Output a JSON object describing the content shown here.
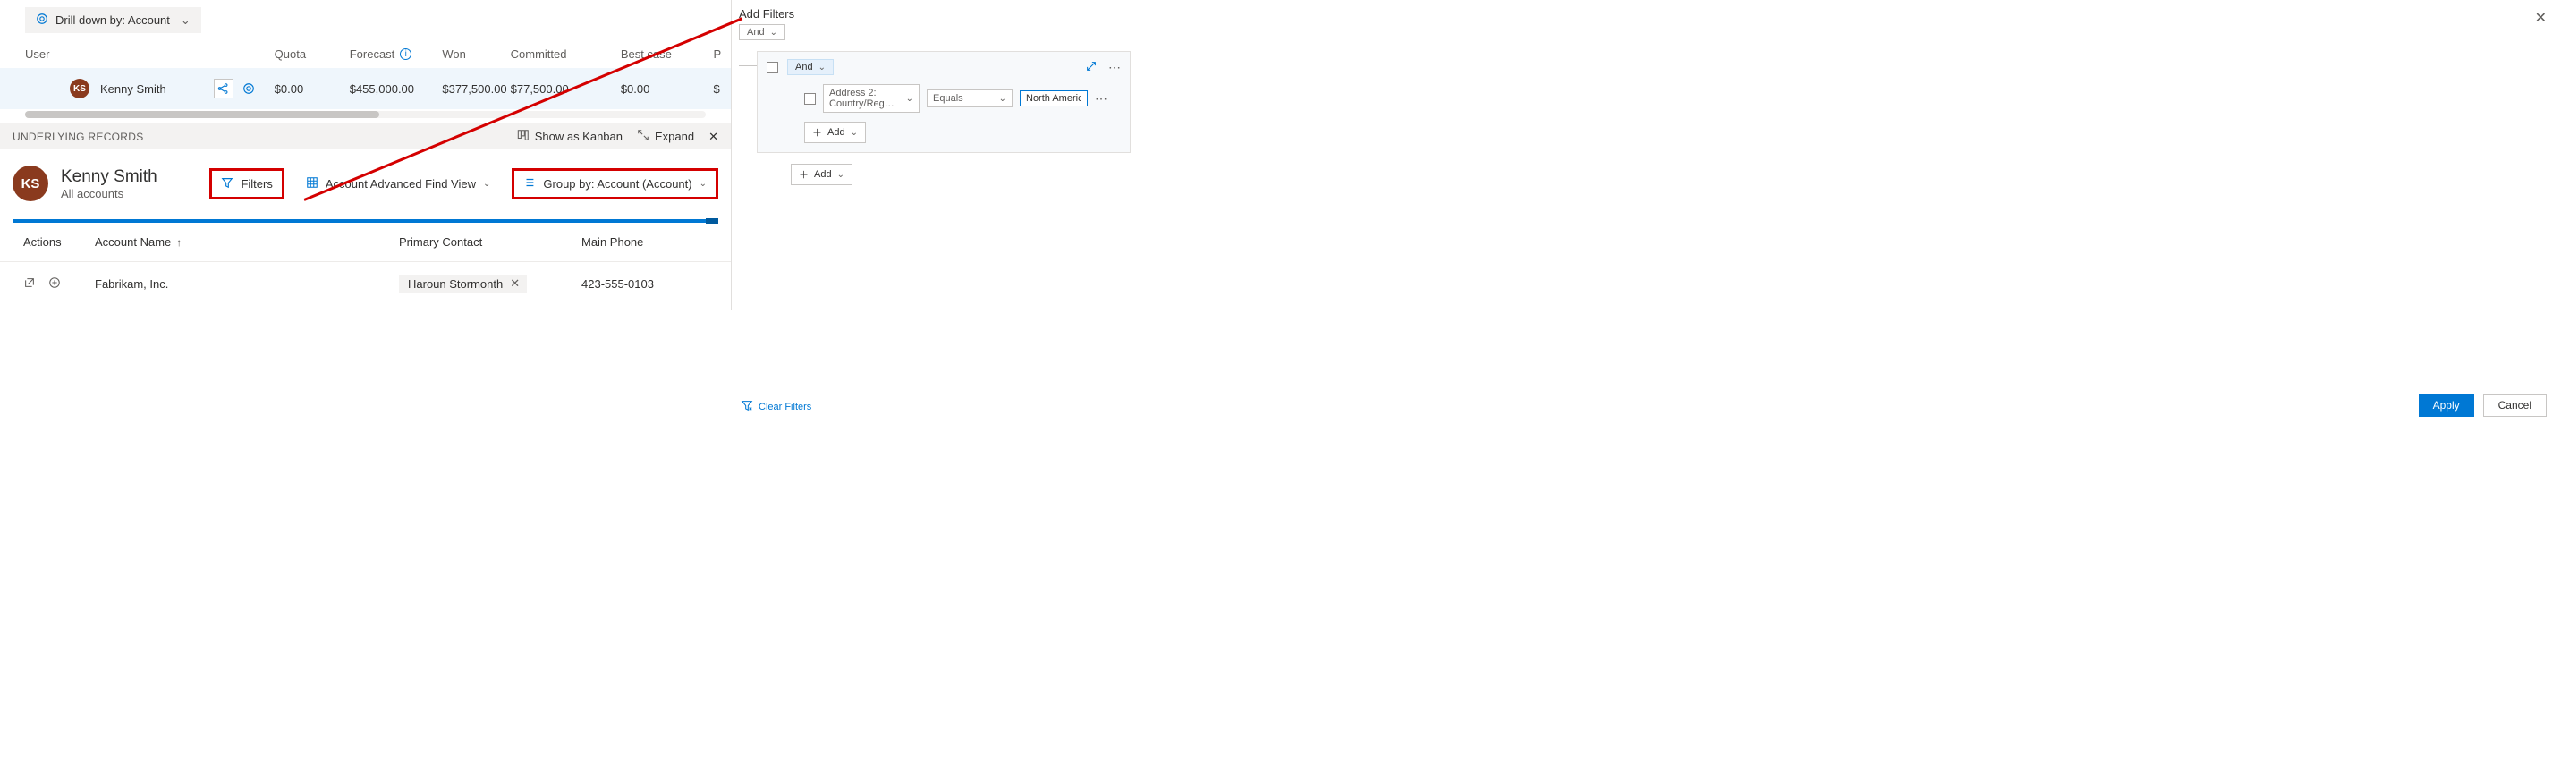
{
  "drilldown": {
    "label": "Drill down by: Account"
  },
  "grid": {
    "headers": {
      "user": "User",
      "quota": "Quota",
      "forecast": "Forecast",
      "won": "Won",
      "committed": "Committed",
      "bestcase": "Best case",
      "pipeline": "P"
    },
    "row": {
      "initials": "KS",
      "name": "Kenny Smith",
      "quota": "$0.00",
      "forecast": "$455,000.00",
      "won": "$377,500.00",
      "committed": "$77,500.00",
      "bestcase": "$0.00",
      "pipeline": "$"
    }
  },
  "underlying": {
    "label": "UNDERLYING RECORDS",
    "kanban": "Show as Kanban",
    "expand": "Expand"
  },
  "detail": {
    "initials": "KS",
    "name": "Kenny Smith",
    "subtitle": "All accounts",
    "filters": "Filters",
    "view": "Account Advanced Find View",
    "groupby": "Group by:  Account (Account)"
  },
  "table": {
    "headers": {
      "actions": "Actions",
      "name": "Account Name",
      "contact": "Primary Contact",
      "phone": "Main Phone"
    },
    "row": {
      "name": "Fabrikam, Inc.",
      "contact": "Haroun Stormonth",
      "phone": "423-555-0103"
    }
  },
  "filters": {
    "title": "Add Filters",
    "and": "And",
    "field": "Address 2: Country/Reg…",
    "operator": "Equals",
    "value": "North America",
    "add": "Add",
    "clear": "Clear Filters",
    "apply": "Apply",
    "cancel": "Cancel"
  }
}
